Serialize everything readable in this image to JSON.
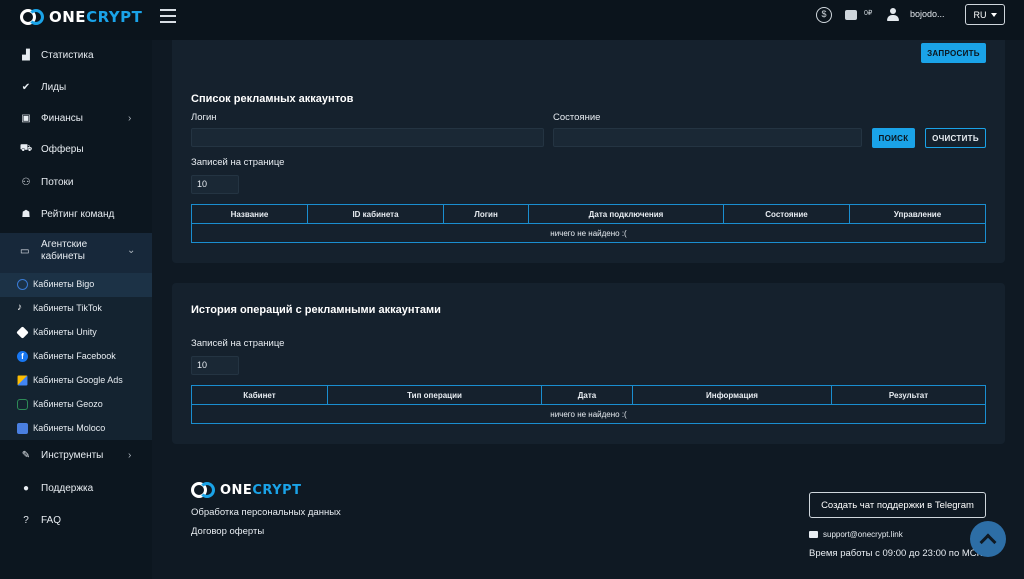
{
  "brand": {
    "one": "ONE",
    "crypt": "CRYPT"
  },
  "header": {
    "balance": "0₽",
    "username": "bojodo...",
    "lang": "RU",
    "icons": [
      "coin-swap-icon",
      "wallet-icon",
      "user-icon"
    ]
  },
  "sidebar": {
    "items": [
      {
        "label": "Статистика",
        "icon": "chart-icon"
      },
      {
        "label": "Лиды",
        "icon": "check-circle-icon"
      },
      {
        "label": "Финансы",
        "icon": "money-icon",
        "has_children": true
      },
      {
        "label": "Офферы",
        "icon": "cart-icon"
      },
      {
        "label": "Потоки",
        "icon": "flow-icon"
      },
      {
        "label": "Рейтинг команд",
        "icon": "team-icon"
      },
      {
        "label": "Агентские кабинеты",
        "icon": "laptop-icon",
        "expanded": true
      },
      {
        "label": "Инструменты",
        "icon": "wrench-icon",
        "has_children": true
      },
      {
        "label": "Поддержка",
        "icon": "chat-icon"
      },
      {
        "label": "FAQ",
        "icon": "question-icon"
      }
    ],
    "agency_line1": "Агентские",
    "agency_line2": "кабинеты",
    "sub_items": [
      {
        "label": "Кабинеты Bigo",
        "icon": "bigo-icon",
        "active": true,
        "color": "#3a7bd5"
      },
      {
        "label": "Кабинеты TikTok",
        "icon": "tiktok-icon",
        "color": "#ffffff"
      },
      {
        "label": "Кабинеты Unity",
        "icon": "unity-icon",
        "color": "#ffffff"
      },
      {
        "label": "Кабинеты Facebook",
        "icon": "facebook-icon",
        "color": "#1877f2"
      },
      {
        "label": "Кабинеты Google Ads",
        "icon": "google-ads-icon",
        "color": "#fbbc04"
      },
      {
        "label": "Кабинеты Geozo",
        "icon": "geozo-icon",
        "color": "#2e8b57"
      },
      {
        "label": "Кабинеты Moloco",
        "icon": "moloco-icon",
        "color": "#4a7fe0"
      }
    ]
  },
  "main": {
    "request_button": "ЗАПРОСИТЬ",
    "accounts": {
      "title": "Список рекламных аккаунтов",
      "login_label": "Логин",
      "login_value": "",
      "status_label": "Состояние",
      "status_value": "",
      "search_button": "ПОИСК",
      "clear_button": "ОЧИСТИТЬ",
      "per_page_label": "Записей на странице",
      "per_page_value": "10",
      "columns": [
        "Название",
        "ID кабинета",
        "Логин",
        "Дата подключения",
        "Состояние",
        "Управление"
      ],
      "empty_text": "ничего не найдено :("
    },
    "history": {
      "title": "История операций с рекламными аккаунтами",
      "per_page_label": "Записей на странице",
      "per_page_value": "10",
      "columns": [
        "Кабинет",
        "Тип операции",
        "Дата",
        "Информация",
        "Результат"
      ],
      "empty_text": "ничего не найдено :("
    }
  },
  "footer": {
    "privacy": "Обработка персональных данных",
    "offer": "Договор оферты",
    "telegram_button": "Создать чат поддержки в Telegram",
    "email": "support@onecrypt.link",
    "hours": "Время работы с 09:00 до 23:00 по МСК"
  },
  "colors": {
    "accent": "#1aa3e8",
    "bg": "#0f1923",
    "card": "#15212d"
  }
}
